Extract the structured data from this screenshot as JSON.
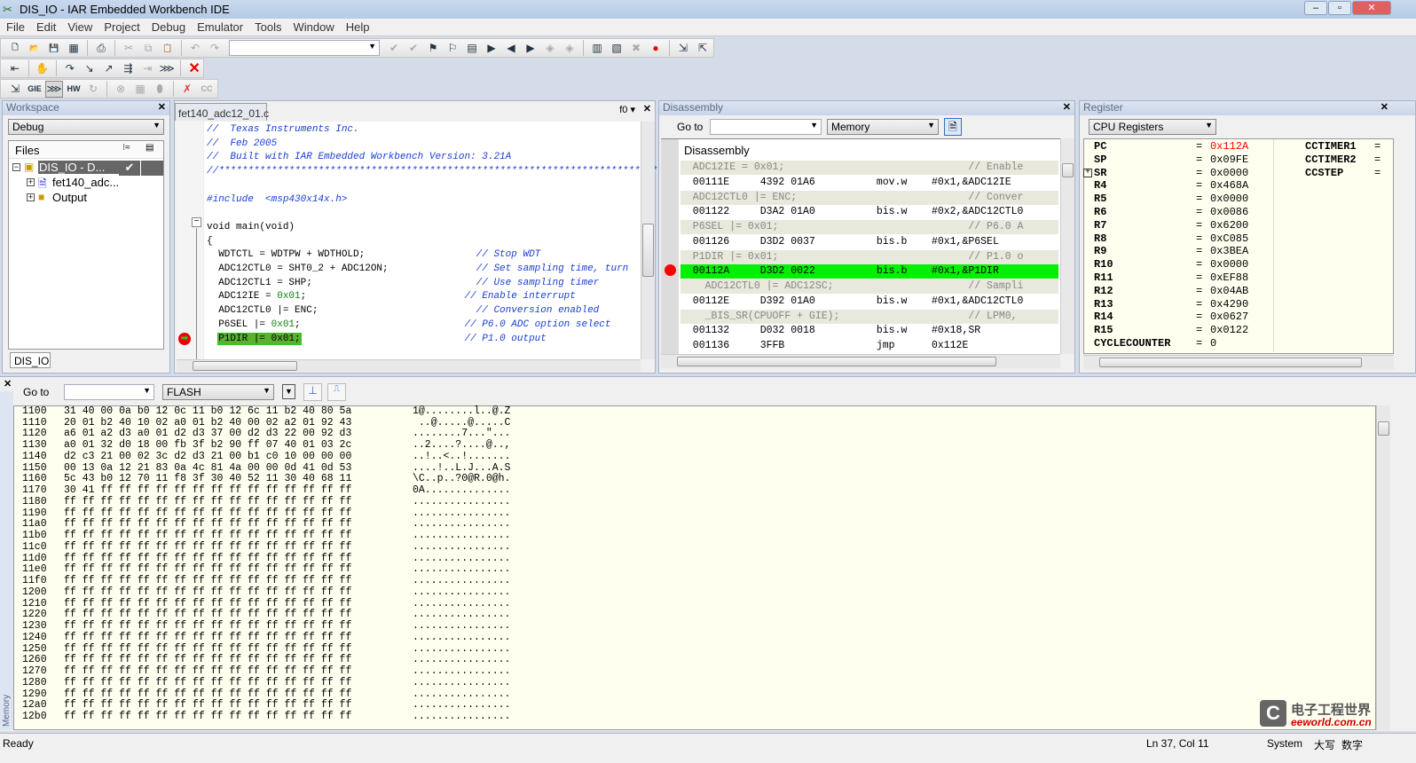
{
  "window": {
    "title": "DIS_IO - IAR Embedded Workbench IDE",
    "buttons": [
      "minimize",
      "maximize",
      "close"
    ]
  },
  "menu": [
    "File",
    "Edit",
    "View",
    "Project",
    "Debug",
    "Emulator",
    "Tools",
    "Window",
    "Help"
  ],
  "toolbar1": [
    {
      "icon": "new-file-icon",
      "g": "🗋"
    },
    {
      "icon": "open-icon",
      "g": "📂"
    },
    {
      "icon": "save-icon",
      "g": "💾"
    },
    {
      "icon": "save-all-icon",
      "g": "▦"
    },
    "sep",
    {
      "icon": "print-icon",
      "g": "⎙"
    },
    "sep",
    {
      "icon": "cut-icon",
      "g": "✂",
      "d": 1
    },
    {
      "icon": "copy-icon",
      "g": "⧉",
      "d": 1
    },
    {
      "icon": "paste-icon",
      "g": "📋",
      "d": 1
    },
    "sep",
    {
      "icon": "undo-icon",
      "g": "↶",
      "d": 1
    },
    {
      "icon": "redo-icon",
      "g": "↷",
      "d": 1
    },
    "combo",
    {
      "icon": "find-icon",
      "g": "✔",
      "d": 1
    },
    {
      "icon": "find-next-icon",
      "g": "✔",
      "d": 1
    },
    {
      "icon": "toggle-bookmark-icon",
      "g": "⚑"
    },
    {
      "icon": "next-bookmark-icon",
      "g": "⚐"
    },
    {
      "icon": "goto-icon",
      "g": "▤"
    },
    {
      "icon": "go-icon",
      "g": "▶"
    },
    {
      "icon": "back-icon",
      "g": "◀"
    },
    {
      "icon": "forward-icon",
      "g": "▶"
    },
    {
      "icon": "compile-icon",
      "g": "◈",
      "d": 1
    },
    {
      "icon": "make-icon",
      "g": "◈",
      "d": 1
    },
    "sep",
    {
      "icon": "debug-icon",
      "g": "▥"
    },
    {
      "icon": "download-icon",
      "g": "▧"
    },
    {
      "icon": "stop-build-icon",
      "g": "✖",
      "d": 1
    },
    {
      "icon": "toggle-breakpoint-icon",
      "g": "●",
      "c": "#e00"
    },
    "sep",
    {
      "icon": "debug-start-icon",
      "g": "⇲"
    },
    {
      "icon": "debug-restart-icon",
      "g": "⇱"
    }
  ],
  "toolbar2": [
    {
      "icon": "reset-icon",
      "g": "⇤"
    },
    "sep",
    {
      "icon": "break-icon",
      "g": "✋",
      "d": 1
    },
    "sep",
    {
      "icon": "step-over-icon",
      "g": "↷"
    },
    {
      "icon": "step-into-icon",
      "g": "↘"
    },
    {
      "icon": "step-out-icon",
      "g": "↗"
    },
    {
      "icon": "next-statement-icon",
      "g": "⇶"
    },
    {
      "icon": "run-to-cursor-icon",
      "g": "⇥",
      "d": 1
    },
    {
      "icon": "go-run-icon",
      "g": "⋙"
    },
    "sep",
    {
      "icon": "stop-debugging-icon",
      "g": "✕",
      "red": 1
    }
  ],
  "toolbar3": [
    {
      "icon": "step-icon",
      "g": "⇲"
    },
    {
      "icon": "gie-icon",
      "g": "GIE"
    },
    {
      "icon": "release-jtag-icon",
      "g": "⋙",
      "p": 1
    },
    {
      "icon": "hw-reset-icon",
      "g": "HW"
    },
    {
      "icon": "cycle-icon",
      "g": "↻",
      "d": 1
    },
    "sep",
    {
      "icon": "state-storage-icon",
      "g": "⊗",
      "d": 1
    },
    {
      "icon": "trace-icon",
      "g": "▦",
      "d": 1
    },
    {
      "icon": "sequencer-icon",
      "g": "⬮",
      "d": 1
    },
    "sep",
    {
      "icon": "clear-breakpoints-icon",
      "g": "✗",
      "c": "#d33"
    },
    {
      "icon": "cc-icon",
      "g": "CC",
      "d": 1
    }
  ],
  "workspace": {
    "title": "Workspace",
    "config": "Debug",
    "files_header": "Files",
    "tree": [
      {
        "label": "DIS_IO - D...",
        "check": "✔",
        "selected": true
      },
      {
        "label": "fet140_adc..."
      },
      {
        "label": "Output"
      }
    ],
    "tab": "DIS_IO"
  },
  "editor": {
    "tab": "fet140_adc12_01.c",
    "func_combo": "f0",
    "lines": [
      [
        [
          "cm",
          "//  Texas Instruments Inc."
        ]
      ],
      [
        [
          "cm",
          "//  Feb 2005"
        ]
      ],
      [
        [
          "cm",
          "//  Built with IAR Embedded Workbench Version: 3.21A"
        ]
      ],
      [
        [
          "cm",
          "//*******************************************************************************"
        ]
      ],
      [],
      [
        [
          "cm",
          "#include  <msp430x14x.h>"
        ]
      ],
      [],
      [
        [
          "t",
          "void main(void)"
        ]
      ],
      [
        [
          "t",
          "{"
        ]
      ],
      [
        [
          "t",
          "  WDTCTL = WDTPW + WDTHOLD;                   "
        ],
        [
          "cm",
          "// Stop WDT"
        ]
      ],
      [
        [
          "t",
          "  ADC12CTL0 = SHT0_2 + ADC12ON;               "
        ],
        [
          "cm",
          "// Set sampling time, turn"
        ]
      ],
      [
        [
          "t",
          "  ADC12CTL1 = SHP;                            "
        ],
        [
          "cm",
          "// Use sampling timer"
        ]
      ],
      [
        [
          "t",
          "  ADC12IE = "
        ],
        [
          "num",
          "0x01"
        ],
        [
          "t",
          ";                           "
        ],
        [
          "cm",
          "// Enable interrupt"
        ]
      ],
      [
        [
          "t",
          "  ADC12CTL0 |= ENC;                           "
        ],
        [
          "cm",
          "// Conversion enabled"
        ]
      ],
      [
        [
          "t",
          "  P6SEL |= "
        ],
        [
          "num",
          "0x01"
        ],
        [
          "t",
          ";                            "
        ],
        [
          "cm",
          "// P6.0 ADC option select"
        ]
      ],
      [
        [
          "t",
          "  "
        ],
        [
          "hl",
          "P1DIR |= 0x01;"
        ],
        [
          "t",
          "                            "
        ],
        [
          "cm",
          "// P1.0 output"
        ]
      ]
    ]
  },
  "disassembly": {
    "title": "Disassembly",
    "goto_label": "Go to",
    "goto_value": "",
    "memory_combo": "Memory",
    "header": "Disassembly",
    "lines": [
      {
        "k": "src",
        "t": "  ADC12IE = 0x01;                              // Enable"
      },
      {
        "k": "asm",
        "t": "  00111E     4392 01A6          mov.w    #0x1,&ADC12IE"
      },
      {
        "k": "src",
        "t": "  ADC12CTL0 |= ENC;                            // Conver"
      },
      {
        "k": "asm",
        "t": "  001122     D3A2 01A0          bis.w    #0x2,&ADC12CTL0"
      },
      {
        "k": "src",
        "t": "  P6SEL |= 0x01;                               // P6.0 A"
      },
      {
        "k": "asm",
        "t": "  001126     D3D2 0037          bis.b    #0x1,&P6SEL"
      },
      {
        "k": "src",
        "t": "  P1DIR |= 0x01;                               // P1.0 o"
      },
      {
        "k": "cur",
        "t": "  00112A     D3D2 0022          bis.b    #0x1,&P1DIR"
      },
      {
        "k": "src",
        "t": "    ADC12CTL0 |= ADC12SC;                      // Sampli"
      },
      {
        "k": "asm",
        "t": "  00112E     D392 01A0          bis.w    #0x1,&ADC12CTL0"
      },
      {
        "k": "src",
        "t": "    _BIS_SR(CPUOFF + GIE);                     // LPM0,"
      },
      {
        "k": "asm",
        "t": "  001132     D032 0018          bis.w    #0x18,SR"
      },
      {
        "k": "asm",
        "t": "  001136     3FFB               jmp      0x112E"
      }
    ]
  },
  "register": {
    "title": "Register",
    "group": "CPU Registers",
    "changed_color": "#ff0000",
    "regs": [
      {
        "n": "PC",
        "v": "0x112A",
        "changed": true
      },
      {
        "n": "SP",
        "v": "0x09FE"
      },
      {
        "n": "SR",
        "v": "0x0000",
        "expand": true
      },
      {
        "n": "R4",
        "v": "0x468A"
      },
      {
        "n": "R5",
        "v": "0x0000"
      },
      {
        "n": "R6",
        "v": "0x0086"
      },
      {
        "n": "R7",
        "v": "0x6200"
      },
      {
        "n": "R8",
        "v": "0xC085"
      },
      {
        "n": "R9",
        "v": "0x3BEA"
      },
      {
        "n": "R10",
        "v": "0x0000"
      },
      {
        "n": "R11",
        "v": "0xEF88"
      },
      {
        "n": "R12",
        "v": "0x04AB"
      },
      {
        "n": "R13",
        "v": "0x4290"
      },
      {
        "n": "R14",
        "v": "0x0627"
      },
      {
        "n": "R15",
        "v": "0x0122"
      },
      {
        "n": "CYCLECOUNTER",
        "v": "0"
      }
    ],
    "regs2": [
      {
        "n": "CCTIMER1",
        "v": "="
      },
      {
        "n": "CCTIMER2",
        "v": "="
      },
      {
        "n": "CCSTEP",
        "v": "="
      }
    ]
  },
  "memory": {
    "side_label": "Memory",
    "goto_label": "Go to",
    "goto_value": "",
    "zone": "FLASH",
    "rows": [
      [
        "1100",
        "31 40 00 0a b0 12 0c 11 b0 12 6c 11 b2 40 80 5a",
        "1@........l..@.Z"
      ],
      [
        "1110",
        "20 01 b2 40 10 02 a0 01 b2 40 00 02 a2 01 92 43",
        " ..@.....@.....C"
      ],
      [
        "1120",
        "a6 01 a2 d3 a0 01 d2 d3 37 00 d2 d3 22 00 92 d3",
        "........7...\"..."
      ],
      [
        "1130",
        "a0 01 32 d0 18 00 fb 3f b2 90 ff 07 40 01 03 2c",
        "..2....?....@..,"
      ],
      [
        "1140",
        "d2 c3 21 00 02 3c d2 d3 21 00 b1 c0 10 00 00 00",
        "..!..<..!......."
      ],
      [
        "1150",
        "00 13 0a 12 21 83 0a 4c 81 4a 00 00 0d 41 0d 53",
        "....!..L.J...A.S"
      ],
      [
        "1160",
        "5c 43 b0 12 70 11 f8 3f 30 40 52 11 30 40 68 11",
        "\\C..p..?0@R.0@h."
      ],
      [
        "1170",
        "30 41 ff ff ff ff ff ff ff ff ff ff ff ff ff ff",
        "0A.............."
      ],
      [
        "1180",
        "ff ff ff ff ff ff ff ff ff ff ff ff ff ff ff ff",
        "................"
      ],
      [
        "1190",
        "ff ff ff ff ff ff ff ff ff ff ff ff ff ff ff ff",
        "................"
      ],
      [
        "11a0",
        "ff ff ff ff ff ff ff ff ff ff ff ff ff ff ff ff",
        "................"
      ],
      [
        "11b0",
        "ff ff ff ff ff ff ff ff ff ff ff ff ff ff ff ff",
        "................"
      ],
      [
        "11c0",
        "ff ff ff ff ff ff ff ff ff ff ff ff ff ff ff ff",
        "................"
      ],
      [
        "11d0",
        "ff ff ff ff ff ff ff ff ff ff ff ff ff ff ff ff",
        "................"
      ],
      [
        "11e0",
        "ff ff ff ff ff ff ff ff ff ff ff ff ff ff ff ff",
        "................"
      ],
      [
        "11f0",
        "ff ff ff ff ff ff ff ff ff ff ff ff ff ff ff ff",
        "................"
      ],
      [
        "1200",
        "ff ff ff ff ff ff ff ff ff ff ff ff ff ff ff ff",
        "................"
      ],
      [
        "1210",
        "ff ff ff ff ff ff ff ff ff ff ff ff ff ff ff ff",
        "................"
      ],
      [
        "1220",
        "ff ff ff ff ff ff ff ff ff ff ff ff ff ff ff ff",
        "................"
      ],
      [
        "1230",
        "ff ff ff ff ff ff ff ff ff ff ff ff ff ff ff ff",
        "................"
      ],
      [
        "1240",
        "ff ff ff ff ff ff ff ff ff ff ff ff ff ff ff ff",
        "................"
      ],
      [
        "1250",
        "ff ff ff ff ff ff ff ff ff ff ff ff ff ff ff ff",
        "................"
      ],
      [
        "1260",
        "ff ff ff ff ff ff ff ff ff ff ff ff ff ff ff ff",
        "................"
      ],
      [
        "1270",
        "ff ff ff ff ff ff ff ff ff ff ff ff ff ff ff ff",
        "................"
      ],
      [
        "1280",
        "ff ff ff ff ff ff ff ff ff ff ff ff ff ff ff ff",
        "................"
      ],
      [
        "1290",
        "ff ff ff ff ff ff ff ff ff ff ff ff ff ff ff ff",
        "................"
      ],
      [
        "12a0",
        "ff ff ff ff ff ff ff ff ff ff ff ff ff ff ff ff",
        "................"
      ],
      [
        "12b0",
        "ff ff ff ff ff ff ff ff ff ff ff ff ff ff ff ff",
        "................"
      ]
    ]
  },
  "watermark": {
    "cn": "电子工程世界",
    "en": "eeworld.com.cn"
  },
  "status": {
    "left": "Ready",
    "pos": "Ln 37, Col 11",
    "mode": "System",
    "caps": "大写",
    "num": "数字"
  },
  "colors": {
    "current_line": "#00f000",
    "breakpoint": "#ff0000",
    "memory_bg": "#fffff0",
    "comment": "#1a3fd0"
  }
}
